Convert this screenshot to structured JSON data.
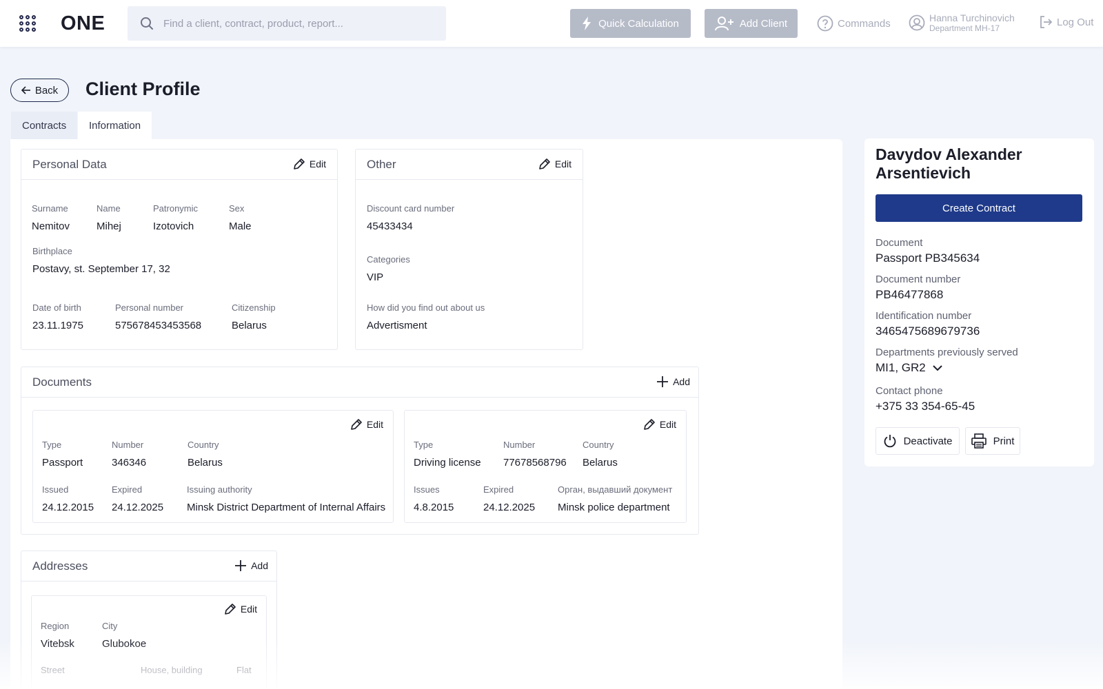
{
  "header": {
    "logo": "ONE",
    "search_placeholder": "Find a client, contract, product, report...",
    "quick_calc": "Quick Calculation",
    "add_client": "Add Client",
    "commands": "Commands",
    "user_name": "Hanna Turchinovich",
    "user_dept": "Department MH-17",
    "logout": "Log Out"
  },
  "page": {
    "back": "Back",
    "title": "Client Profile",
    "tabs": [
      {
        "label": "Contracts",
        "active": false
      },
      {
        "label": "Information",
        "active": true
      }
    ]
  },
  "personal": {
    "title": "Personal Data",
    "edit": "Edit",
    "surname_label": "Surname",
    "surname": "Nemitov",
    "name_label": "Name",
    "name": "Mihej",
    "patronymic_label": "Patronymic",
    "patronymic": "Izotovich",
    "sex_label": "Sex",
    "sex": "Male",
    "birthplace_label": "Birthplace",
    "birthplace": "Postavy, st. September 17, 32",
    "dob_label": "Date of birth",
    "dob": "23.11.1975",
    "personal_number_label": "Personal number",
    "personal_number": "575678453453568",
    "citizenship_label": "Citizenship",
    "citizenship": "Belarus"
  },
  "other": {
    "title": "Other",
    "edit": "Edit",
    "discount_label": "Discount card number",
    "discount": "45433434",
    "categories_label": "Categories",
    "categories": "VIP",
    "source_label": "How did you find out about us",
    "source": "Advertisment"
  },
  "documents": {
    "title": "Documents",
    "add": "Add",
    "items": [
      {
        "edit": "Edit",
        "type_label": "Type",
        "type": "Passport",
        "number_label": "Number",
        "number": "346346",
        "country_label": "Country",
        "country": "Belarus",
        "issued_label": "Issued",
        "issued": "24.12.2015",
        "expired_label": "Expired",
        "expired": "24.12.2025",
        "authority_label": "Issuing authority",
        "authority": "Minsk District Department of Internal Affairs"
      },
      {
        "edit": "Edit",
        "type_label": "Type",
        "type": "Driving license",
        "number_label": "Number",
        "number": "77678568796",
        "country_label": "Country",
        "country": "Belarus",
        "issued_label": "Issues",
        "issued": "4.8.2015",
        "expired_label": "Expired",
        "expired": "24.12.2025",
        "authority_label": "Орган, выдавший документ",
        "authority": "Minsk police department"
      }
    ]
  },
  "addresses": {
    "title": "Addresses",
    "add": "Add",
    "items": [
      {
        "edit": "Edit",
        "region_label": "Region",
        "region": "Vitebsk",
        "city_label": "City",
        "city": "Glubokoe",
        "street_label": "Street",
        "house_label": "House, building",
        "flat_label": "Flat"
      }
    ]
  },
  "sidebar": {
    "client_name": "Davydov Alexander Arsentievich",
    "create_contract": "Create Contract",
    "document_label": "Document",
    "document": "Passport PB345634",
    "doc_number_label": "Document number",
    "doc_number": "PB46477868",
    "id_label": "Identification number",
    "id": "3465475689679736",
    "departments_label": "Departments previously served",
    "departments": "MI1, GR2",
    "phone_label": "Contact phone",
    "phone": "+375 33 354-65-45",
    "deactivate": "Deactivate",
    "print": "Print"
  },
  "colors": {
    "accent": "#1f3a8a",
    "background": "#f1f4fa",
    "disabled_button": "#b6bbc8"
  }
}
